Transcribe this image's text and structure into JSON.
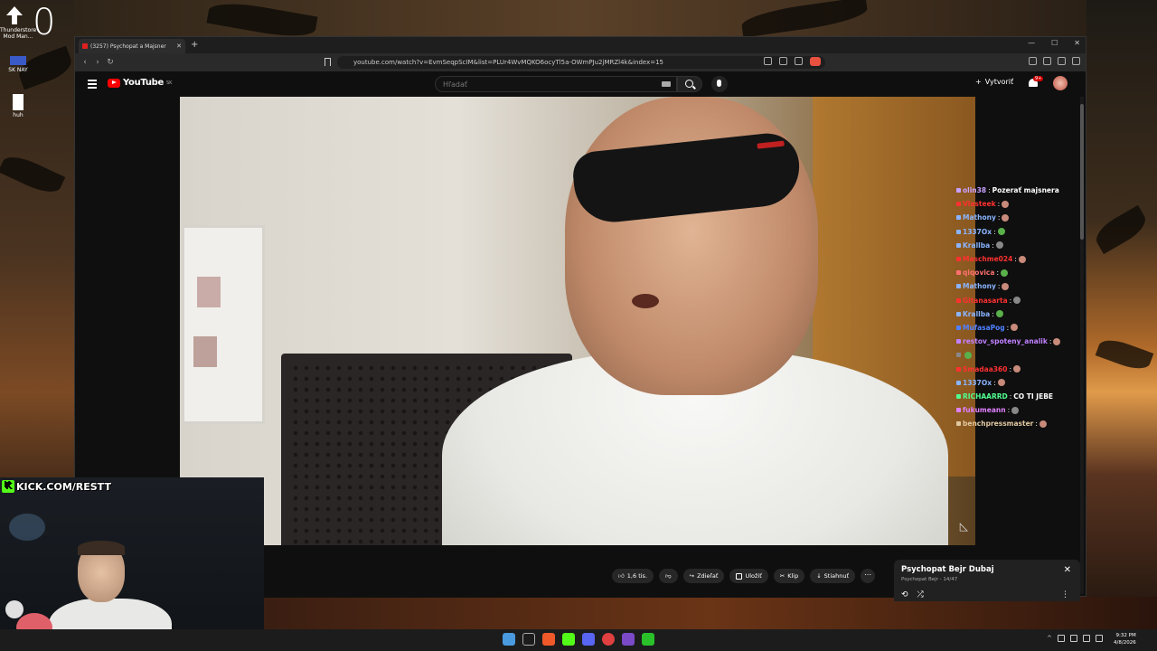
{
  "desktop": {
    "timer": "0",
    "icons": [
      {
        "label": "Thunderstore Mod Man..."
      },
      {
        "label": "SK NAY"
      },
      {
        "label": "huh"
      }
    ]
  },
  "browser": {
    "tab_title": "(3257) Psychopat a Majsner",
    "url": "youtube.com/watch?v=EvmSeqpScIM&list=PLUr4WvMQKO6ocyTl5a-OWmPJu2jMRZl4k&index=15"
  },
  "youtube": {
    "logo_text": "YouTube",
    "country": "SK",
    "search_placeholder": "Hľadať",
    "create_label": "Vytvoriť",
    "notif_badge": "9+",
    "actions": {
      "likes": "1,6 tis.",
      "share": "Zdieľať",
      "save": "Uložiť",
      "clip": "Klip",
      "download": "Stiahnuť"
    },
    "playlist": {
      "title": "Psychopat Bejr  Dubaj",
      "subtitle": "Psychopat Bejr - 14/47"
    }
  },
  "chat": [
    {
      "user": "olin38",
      "color": "#c8a0ff",
      "msg": "Pozerať majsnera"
    },
    {
      "user": "Vlasteek",
      "color": "#ff3030",
      "msg": ""
    },
    {
      "user": "Mathony",
      "color": "#8ab4ff",
      "msg": ""
    },
    {
      "user": "1337Ox",
      "color": "#8ab4ff",
      "msg": ""
    },
    {
      "user": "Krallba",
      "color": "#8ab4ff",
      "msg": ""
    },
    {
      "user": "Maschme024",
      "color": "#ff3030",
      "msg": ""
    },
    {
      "user": "qiqovica",
      "color": "#ff7070",
      "msg": ""
    },
    {
      "user": "Mathony",
      "color": "#8ab4ff",
      "msg": ""
    },
    {
      "user": "Gitanasarta",
      "color": "#ff3030",
      "msg": ""
    },
    {
      "user": "Krallba",
      "color": "#8ab4ff",
      "msg": ""
    },
    {
      "user": "MufasaPog",
      "color": "#5080ff",
      "msg": ""
    },
    {
      "user": "restov_spoteny_analik",
      "color": "#c080ff",
      "msg": ""
    },
    {
      "user": "",
      "color": "#888",
      "msg": ""
    },
    {
      "user": "Smadaa360",
      "color": "#ff3030",
      "msg": ""
    },
    {
      "user": "1337Ox",
      "color": "#8ab4ff",
      "msg": ""
    },
    {
      "user": "RICHAARRD",
      "color": "#50ff90",
      "msg": "CO TI JEBE"
    },
    {
      "user": "fukumeann",
      "color": "#e080ff",
      "msg": ""
    },
    {
      "user": "benchpressmaster",
      "color": "#e0c8a0",
      "msg": ""
    }
  ],
  "webcam": {
    "kick_label": "KICK.COM/RESTT",
    "kick_letter": "K"
  },
  "taskbar": {
    "time": "9:32 PM",
    "date": "4/8/2026"
  }
}
